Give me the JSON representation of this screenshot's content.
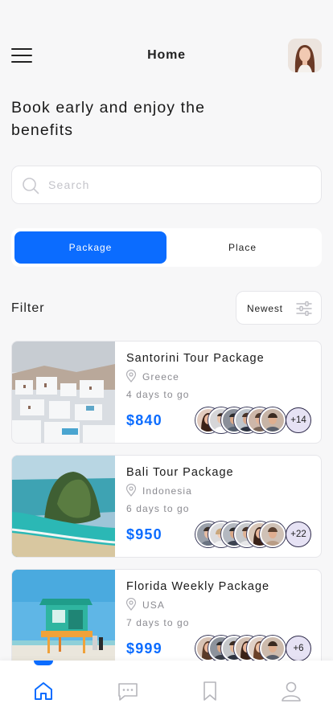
{
  "header": {
    "title": "Home"
  },
  "headline": "Book early and enjoy the benefits",
  "search": {
    "placeholder": "Search",
    "value": ""
  },
  "segments": {
    "active": "Package",
    "inactive": "Place"
  },
  "filter": {
    "label": "Filter",
    "sort_label": "Newest"
  },
  "packages": [
    {
      "title": "Santorini Tour Package",
      "location": "Greece",
      "days": "4 days to go",
      "price": "$840",
      "extra": "+14"
    },
    {
      "title": "Bali Tour Package",
      "location": "Indonesia",
      "days": "6 days to go",
      "price": "$950",
      "extra": "+22"
    },
    {
      "title": "Florida Weekly Package",
      "location": "USA",
      "days": "7 days to go",
      "price": "$999",
      "extra": "+6"
    }
  ],
  "tabbar": {
    "active": "home",
    "items": [
      "home-icon",
      "chat-icon",
      "bookmark-icon",
      "profile-icon"
    ]
  },
  "colors": {
    "accent": "#0b6cff",
    "background": "#f7f7f8"
  }
}
